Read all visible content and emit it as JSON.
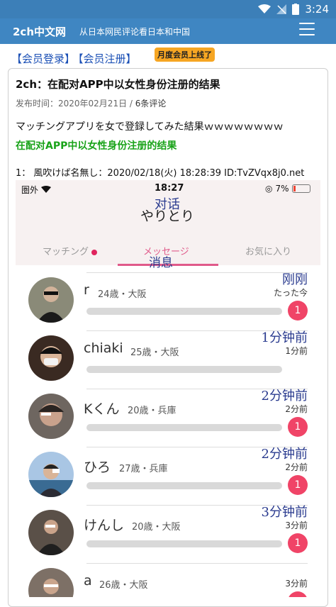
{
  "status_bar": {
    "time": "3:24"
  },
  "app": {
    "brand": "2ch中文网",
    "tagline": "从日本网民评论看日本和中国"
  },
  "links": {
    "login": "【会员登录】",
    "register": "【会员注册】",
    "badge": "月度会员上线了"
  },
  "article": {
    "title": "2ch：在配对APP中以女性身份注册的结果",
    "meta_date": "发布时间：2020年02月21日 /",
    "meta_comments": "6条评论",
    "jp_line": "マッチングアプリを女で登録してみた結果ｗｗｗｗｗｗｗｗ",
    "cn_line": "在配对APP中以女性身份注册的结果",
    "post_header": "1： 風吹けば名無し：2020/02/18(火) 18:28:39 ID:TvZVqx8j0.net"
  },
  "screenshot": {
    "carrier": "圏外",
    "time": "18:27",
    "battery": "7%",
    "header_cn": "对话",
    "header_jp": "やりとり",
    "tabs": [
      "マッチング",
      "メッセージ",
      "お気に入り"
    ],
    "messages_cn": "消息",
    "items": [
      {
        "name": "r",
        "info": "24歳・大阪",
        "time": "たった今",
        "time_cn": "刚刚",
        "unread": "1"
      },
      {
        "name": "chiaki",
        "info": "25歳・大阪",
        "time": "1分前",
        "time_cn": "1分钟前",
        "unread": ""
      },
      {
        "name": "Kくん",
        "info": "20歳・兵庫",
        "time": "2分前",
        "time_cn": "2分钟前",
        "unread": "1"
      },
      {
        "name": "ひろ",
        "info": "27歳・兵庫",
        "time": "2分前",
        "time_cn": "2分钟前",
        "unread": "1"
      },
      {
        "name": "けんし",
        "info": "20歳・大阪",
        "time": "3分前",
        "time_cn": "3分钟前",
        "unread": "1"
      },
      {
        "name": "a",
        "info": "26歳・大阪",
        "time": "3分前",
        "time_cn": "",
        "unread": ""
      }
    ]
  },
  "colors": {
    "appbar": "#3f86c2",
    "link": "#1a4fb5",
    "green": "#19a319",
    "unread": "#f04467",
    "pink": "#e05a8a"
  }
}
